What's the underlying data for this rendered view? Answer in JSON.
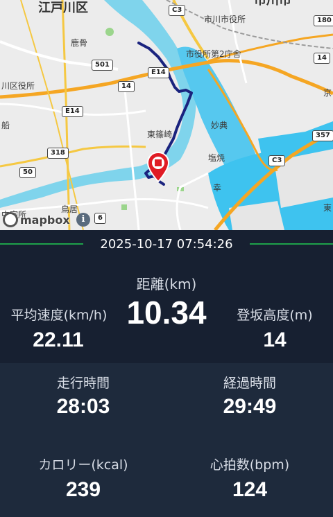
{
  "map": {
    "labels": {
      "edogawa_ku": "江戸川区",
      "ichikawa_shi": "市川市",
      "ichikawa_city_hall": "市川市役所",
      "city_hall_2nd": "市役所第2庁舎",
      "kasai": "鹿骨",
      "ward_office": "川区役所",
      "higashi_shinozaki": "東篠崎",
      "myoden": "妙典",
      "shiohama": "塩焼",
      "saiwai": "幸",
      "ichinoe": "鳥居",
      "funabori": "船",
      "chuo": "中宗所",
      "kei": "京",
      "e": "東"
    },
    "shields": {
      "c3_top": "C3",
      "r180": "180",
      "r501": "501",
      "e14_a": "E14",
      "r14_a": "14",
      "e14_b": "E14",
      "r14_b": "14",
      "r357": "357",
      "c3_bottom": "C3",
      "r318": "318",
      "r50": "50",
      "r6": "6"
    },
    "attribution": "mapbox",
    "info_glyph": "i",
    "route_color": "#1a237e",
    "pin_color": "#e01b24"
  },
  "session": {
    "datetime": "2025-10-17 07:54:26",
    "accent_color": "#1ea24a"
  },
  "metrics": {
    "distance": {
      "label": "距離(km)",
      "value": "10.34"
    },
    "avg_speed": {
      "label": "平均速度(km/h)",
      "value": "22.11"
    },
    "elevation": {
      "label": "登坂高度(m)",
      "value": "14"
    },
    "moving_time": {
      "label": "走行時間",
      "value": "28:03"
    },
    "elapsed_time": {
      "label": "経過時間",
      "value": "29:49"
    },
    "calories": {
      "label": "カロリー(kcal)",
      "value": "239"
    },
    "heart_rate": {
      "label": "心拍数(bpm)",
      "value": "124"
    }
  }
}
